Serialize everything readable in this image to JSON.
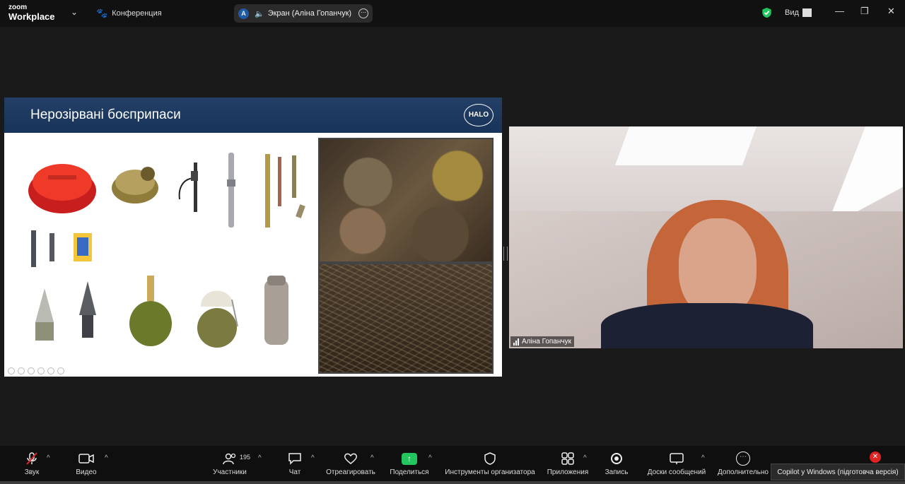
{
  "app": {
    "logo_top": "zoom",
    "logo_bottom": "Workplace",
    "meeting_title": "Конференция"
  },
  "screen_share": {
    "avatar_letter": "A",
    "label": "Экран (Аліна Гопанчук)"
  },
  "header_right": {
    "view_label": "Вид"
  },
  "window_controls": {
    "minimize": "—",
    "restore": "❐",
    "close": "✕"
  },
  "slide": {
    "title": "Нерозірвані боєприпаси",
    "logo_text": "HALO"
  },
  "participant": {
    "name": "Аліна Гопанчук"
  },
  "toolbar": {
    "audio": "Звук",
    "video": "Видео",
    "participants": "Участники",
    "participants_count": "195",
    "chat": "Чат",
    "react": "Отреагировать",
    "share": "Поделиться",
    "host_tools": "Инструменты организатора",
    "apps": "Приложения",
    "record": "Запись",
    "whiteboards": "Доски сообщений",
    "more": "Дополнительно"
  },
  "copilot_tooltip": "Copilot у Windows (підготовча версія)",
  "colors": {
    "share_green": "#22c55e",
    "slide_header": "#1c3a60",
    "leave_red": "#e02424",
    "mute_red": "#e02424"
  }
}
